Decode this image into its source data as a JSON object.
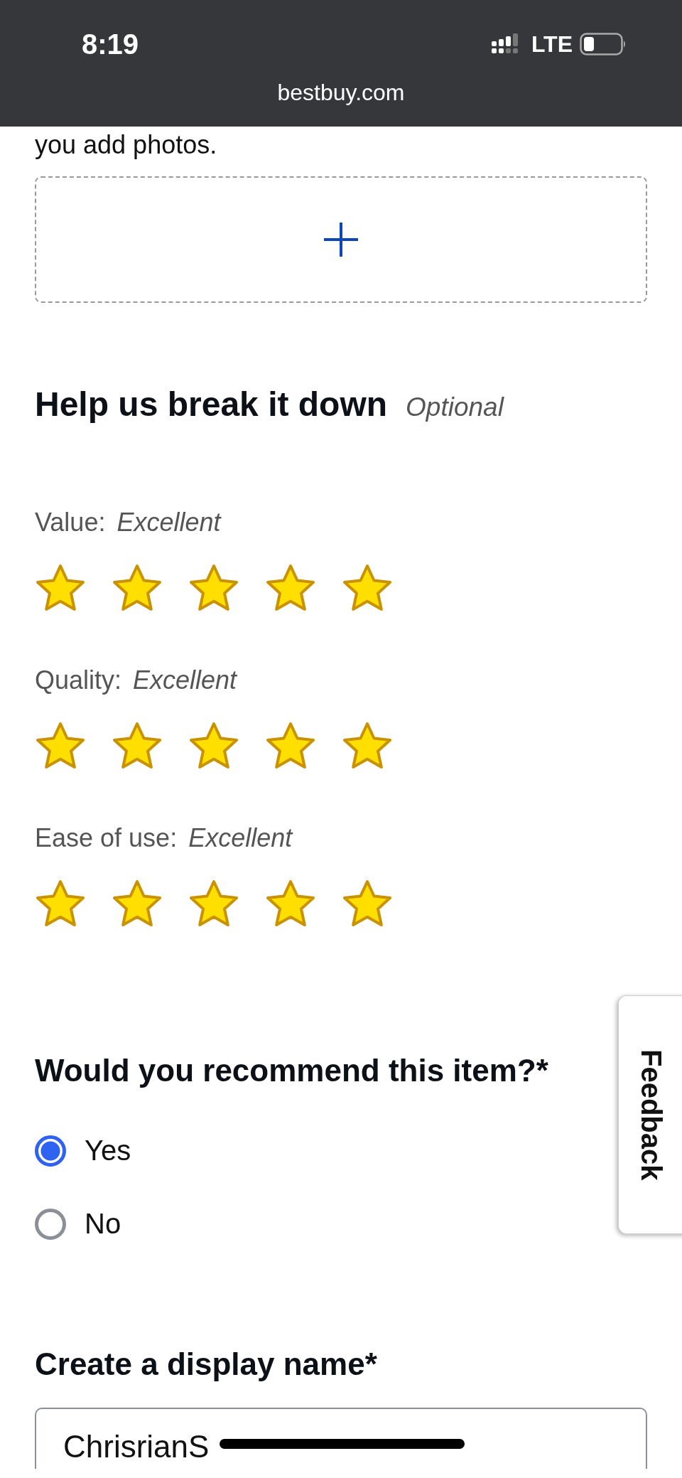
{
  "status_bar": {
    "time": "8:19",
    "network": "LTE"
  },
  "browser": {
    "url": "bestbuy.com"
  },
  "photos_note": "you add photos.",
  "breakdown": {
    "title": "Help us break it down",
    "optional": "Optional",
    "ratings": [
      {
        "label": "Value:",
        "value": "Excellent",
        "stars": 5
      },
      {
        "label": "Quality:",
        "value": "Excellent",
        "stars": 5
      },
      {
        "label": "Ease of use:",
        "value": "Excellent",
        "stars": 5
      }
    ]
  },
  "recommend": {
    "question": "Would you recommend this item?*",
    "options": [
      {
        "label": "Yes",
        "selected": true
      },
      {
        "label": "No",
        "selected": false
      }
    ]
  },
  "display_name": {
    "label": "Create a display name*",
    "value": "ChrisrianS"
  },
  "feedback_tab": "Feedback"
}
